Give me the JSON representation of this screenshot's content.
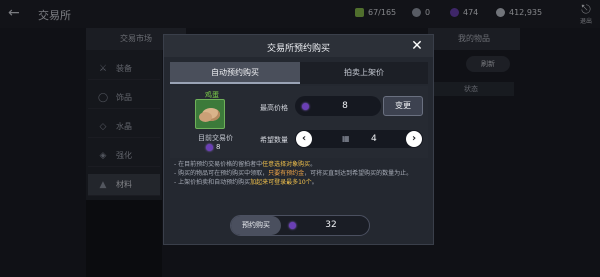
{
  "topbar": {
    "title": "交易所",
    "back_icon": "arrow-left-icon",
    "resources": [
      {
        "icon": "capacity-icon",
        "value": "67/165",
        "color": "#8bc34a"
      },
      {
        "icon": "silver-coin-icon",
        "value": "0",
        "color": "#9aa0ad"
      },
      {
        "icon": "purple-gem-icon",
        "value": "474",
        "color": "#6a3fb5"
      },
      {
        "icon": "white-coin-icon",
        "value": "412,935",
        "color": "#c7ccd6"
      }
    ],
    "exit_label": "退出"
  },
  "background": {
    "market_tab": "交易市场",
    "my_items_tab": "我的物品",
    "refresh": "刷新",
    "status": "状态",
    "categories": [
      {
        "icon": "sword-icon",
        "label": "装备",
        "selected": false
      },
      {
        "icon": "ring-icon",
        "label": "饰品",
        "selected": false
      },
      {
        "icon": "crystal-icon",
        "label": "水晶",
        "selected": false
      },
      {
        "icon": "enhance-icon",
        "label": "强化",
        "selected": false
      },
      {
        "icon": "material-icon",
        "label": "材料",
        "selected": true
      }
    ]
  },
  "modal": {
    "title": "交易所预约购买",
    "close_icon": "close-icon",
    "tabs": [
      {
        "label": "自动预约购买",
        "active": true
      },
      {
        "label": "拍卖上架价",
        "active": false
      }
    ],
    "item": {
      "name": "鸡蛋",
      "name_color": "#7fd34a",
      "recent_label": "目前交易价",
      "recent_price": "8"
    },
    "max_price_label": "最高价格",
    "max_price_value": "8",
    "change_button": "变更",
    "qty_label": "希望数量",
    "qty_value": "4",
    "notes": {
      "n1_a": "- 在目前预约交易价格的留拍者中",
      "n1_b": "任意选择对象购买",
      "n1_c": "。",
      "n2_a": "- 购买的物品可在预约购买中领取，",
      "n2_b": "只要有预约金",
      "n2_c": "，可将买直到达到希望购买的数量为止。",
      "n3_a": "- 上架价拍卖和自动预约购买",
      "n3_b": "加起来可登录最多10个",
      "n3_c": "。"
    },
    "buy_button": "预约购买",
    "buy_total": "32"
  }
}
